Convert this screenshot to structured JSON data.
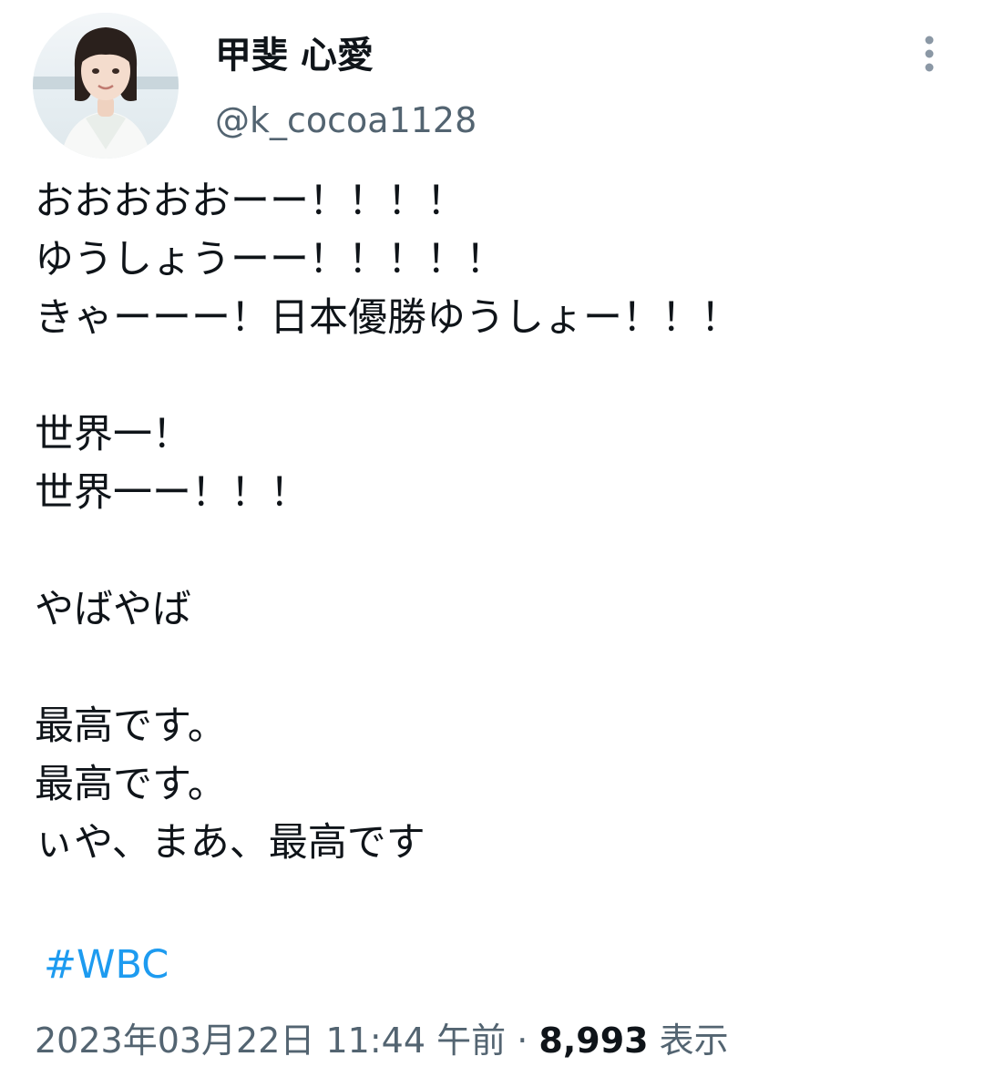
{
  "author": {
    "display_name": "甲斐 心愛",
    "handle": "@k_cocoa1128"
  },
  "tweet": {
    "lines": [
      "おおおおおーー！！！！",
      "ゆうしょうーー！！！！！",
      "きゃーーー！日本優勝ゆうしょー！！！",
      "",
      "世界一！",
      "世界一ー！！！",
      "",
      "やばやば",
      "",
      "最高です。",
      "最高です。",
      "ぃや、まあ、最高です"
    ],
    "hashtag": "#WBC"
  },
  "meta": {
    "timestamp": "2023年03月22日 11:44 午前",
    "separator": "·",
    "views_count": "8,993",
    "views_label": "表示"
  },
  "icons": {
    "more": "more-vertical-icon"
  },
  "colors": {
    "text": "#0f1419",
    "secondary": "#536471",
    "link": "#1d9bf0"
  }
}
